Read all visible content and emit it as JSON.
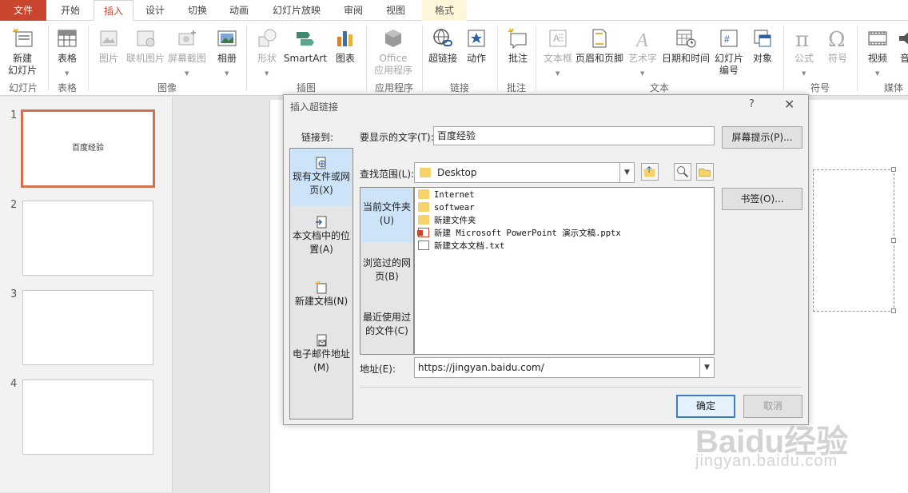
{
  "tabs": [
    "文件",
    "开始",
    "插入",
    "设计",
    "切换",
    "动画",
    "幻灯片放映",
    "审阅",
    "视图",
    "格式"
  ],
  "ribbon": {
    "buttons": {
      "new_slide": "新建\n幻灯片",
      "table": "表格",
      "picture": "图片",
      "online_picture": "联机图片",
      "screenshot": "屏幕截图",
      "album": "相册",
      "shapes": "形状",
      "smartart": "SmartArt",
      "chart": "图表",
      "office_apps": "Office\n应用程序",
      "hyperlink": "超链接",
      "action": "动作",
      "comment": "批注",
      "textbox": "文本框",
      "header_footer": "页眉和页脚",
      "wordart": "艺术字",
      "datetime": "日期和时间",
      "slide_number": "幻灯片\n编号",
      "object": "对象",
      "equation": "公式",
      "symbol": "符号",
      "video": "视频",
      "audio": "音"
    },
    "groups": {
      "slides": "幻灯片",
      "tables": "表格",
      "images": "图像",
      "illustrations": "插图",
      "apps": "应用程序",
      "links": "链接",
      "comments": "批注",
      "text": "文本",
      "symbols": "符号",
      "media": "媒体"
    }
  },
  "thumbnails": {
    "numbers": [
      "1",
      "2",
      "3",
      "4"
    ],
    "slide1_title": "百度经验"
  },
  "dialog": {
    "title": "插入超链接",
    "help": "?",
    "close": "✕",
    "link_to_label": "链接到:",
    "link_options": [
      "现有文件或网页(X)",
      "本文档中的位置(A)",
      "新建文档(N)",
      "电子邮件地址(M)"
    ],
    "display_text_label": "要显示的文字(T):",
    "display_text_value": "百度经验",
    "screen_tip_button": "屏幕提示(P)...",
    "look_in_label": "查找范围(L):",
    "look_in_value": "Desktop",
    "bookmark_button": "书签(O)...",
    "sub_options": [
      "当前文件夹(U)",
      "浏览过的网页(B)",
      "最近使用过的文件(C)"
    ],
    "files": [
      {
        "name": "Internet",
        "type": "folder"
      },
      {
        "name": "softwear",
        "type": "folder"
      },
      {
        "name": "新建文件夹",
        "type": "folder"
      },
      {
        "name": "新建 Microsoft PowerPoint 演示文稿.pptx",
        "type": "pptx"
      },
      {
        "name": "新建文本文档.txt",
        "type": "txt"
      }
    ],
    "address_label": "地址(E):",
    "address_value": "https://jingyan.baidu.com/",
    "ok_button": "确定",
    "cancel_button": "取消"
  },
  "watermark": {
    "line1": "Baidu经验",
    "line2": "jingyan.baidu.com"
  },
  "colors": {
    "accent": "#c9452e",
    "selection": "#cde3f7",
    "thumb_selected_border": "#d4704f"
  }
}
